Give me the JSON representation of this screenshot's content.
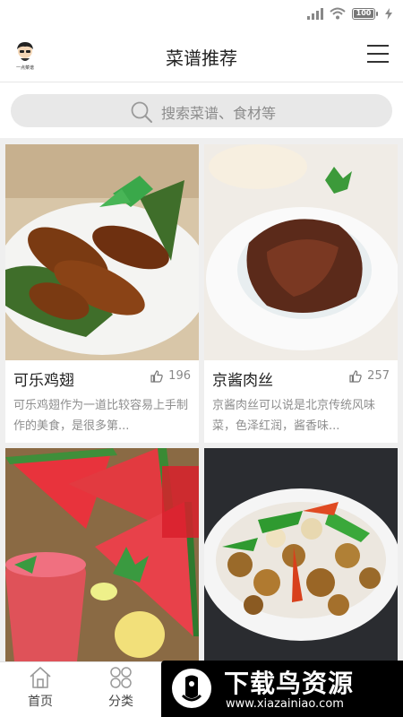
{
  "status_bar": {
    "battery": "100"
  },
  "header": {
    "title": "菜谱推荐",
    "avatar_caption": "一点菜谱"
  },
  "search": {
    "placeholder": "搜索菜谱、食材等"
  },
  "recipes": [
    {
      "title": "可乐鸡翅",
      "likes": "196",
      "description": "可乐鸡翅作为一道比较容易上手制作的美食，是很多第..."
    },
    {
      "title": "京酱肉丝",
      "likes": "257",
      "description": "京酱肉丝可以说是北京传统风味菜，色泽红润，酱香味..."
    },
    {
      "title": "",
      "likes": "",
      "description": ""
    },
    {
      "title": "",
      "likes": "",
      "description": ""
    }
  ],
  "tabbar": {
    "home_label": "首页",
    "category_label": "分类"
  },
  "watermark": {
    "title": "下载鸟资源",
    "url": "www.xiazainiao.com"
  },
  "colors": {
    "accent": "#222222",
    "muted": "#8e8e8e",
    "search_bg": "#e8e8e8"
  },
  "icons": [
    "signal-icon",
    "wifi-icon",
    "battery-icon",
    "bolt-icon",
    "avatar",
    "menu-icon",
    "search-icon",
    "thumbs-up-icon",
    "home-icon",
    "category-icon"
  ]
}
